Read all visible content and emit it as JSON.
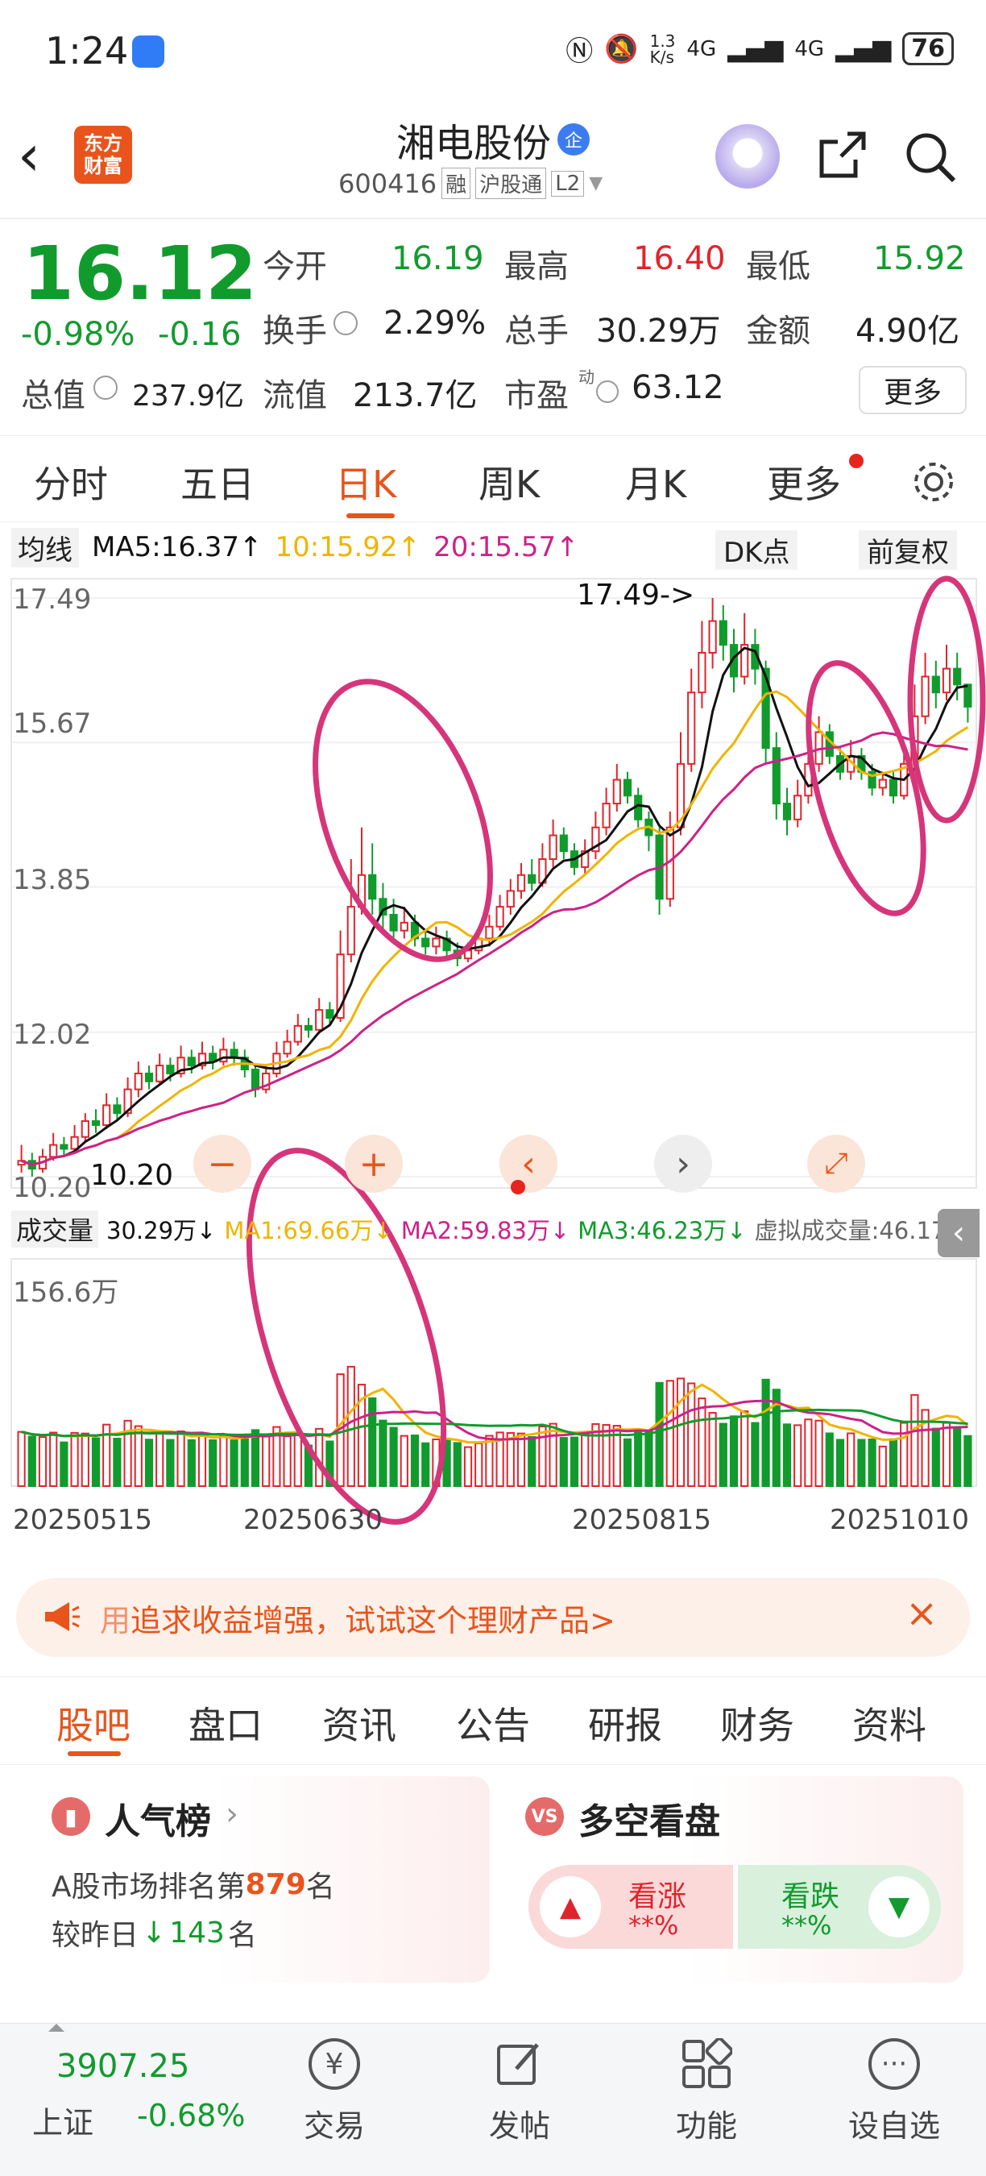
{
  "status_bar": {
    "time": "1:24",
    "net_speed_top": "1.3",
    "net_speed_unit": "K/s",
    "signal1": "4G",
    "signal2": "4G",
    "battery": "76"
  },
  "header": {
    "logo_line1": "东方",
    "logo_line2": "财富",
    "stock_name": "湘电股份",
    "badge": "企",
    "code": "600416",
    "tag1": "融",
    "tag2": "沪股通",
    "tag3": "L2"
  },
  "quote": {
    "price": "16.12",
    "change_pct": "-0.98%",
    "change": "-0.16",
    "open_label": "今开",
    "open": "16.19",
    "high_label": "最高",
    "high": "16.40",
    "low_label": "最低",
    "low": "15.92",
    "turnover_label": "换手",
    "turnover": "2.29%",
    "volume_label": "总手",
    "volume": "30.29万",
    "amount_label": "金额",
    "amount": "4.90亿",
    "mktcap_label": "总值",
    "mktcap": "237.9亿",
    "float_label": "流值",
    "float": "213.7亿",
    "pe_label": "市盈",
    "pe_sup": "动",
    "pe": "63.12",
    "more": "更多"
  },
  "tabs": [
    "分时",
    "五日",
    "日K",
    "周K",
    "月K",
    "更多"
  ],
  "active_tab": 2,
  "ma_bar": {
    "ma_type": "均线",
    "ma5": "MA5:16.37↑",
    "ma10": "10:15.92↑",
    "ma20": "20:15.57↑",
    "dk": "DK点",
    "adjust": "前复权"
  },
  "price_axis": [
    "17.49",
    "15.67",
    "13.85",
    "12.02",
    "10.20"
  ],
  "annotations": {
    "high_marker": "17.49->",
    "low_marker": "10.20"
  },
  "vol_bar": {
    "label": "成交量",
    "vol": "30.29万↓",
    "ma1": "MA1:69.66万↓",
    "ma2": "MA2:59.83万↓",
    "ma3": "MA3:46.23万↓",
    "virtual": "虚拟成交量:46.17万"
  },
  "vol_axis_top": "156.6万",
  "date_axis": [
    "20250515",
    "20250630",
    "20250815",
    "20251010"
  ],
  "colors": {
    "up": "#e0242c",
    "down": "#119b2d",
    "ma5": "#111111",
    "ma10": "#f0b400",
    "ma20": "#cc2288",
    "accent": "#e8541c"
  },
  "banner": {
    "text_prefix": "用",
    "text": "追求收益增强，试试这个理财产品>"
  },
  "subtabs": [
    "股吧",
    "盘口",
    "资讯",
    "公告",
    "研报",
    "财务",
    "资料"
  ],
  "active_subtab": 0,
  "popularity": {
    "title": "人气榜",
    "line1_prefix": "A股市场排名第",
    "rank": "879",
    "line1_suffix": "名",
    "line2_prefix": "较昨日",
    "delta": "143",
    "line2_suffix": "名"
  },
  "sentiment": {
    "title": "多空看盘",
    "bull": "看涨",
    "bull_val": "**%",
    "bear": "看跌",
    "bear_val": "**%"
  },
  "bottom_nav": {
    "index_value": "3907.25",
    "index_name": "上证",
    "index_change": "-0.68%",
    "items": [
      "交易",
      "发帖",
      "功能",
      "设自选"
    ]
  },
  "chart_data": {
    "type": "candlestick",
    "x_dates_shown": [
      "20250515",
      "20250630",
      "20250815",
      "20251010"
    ],
    "y_ticks": [
      17.49,
      15.67,
      13.85,
      12.02,
      10.2
    ],
    "ylim": [
      10.2,
      17.49
    ],
    "candles": [
      [
        10.35,
        10.4,
        10.25,
        10.6
      ],
      [
        10.4,
        10.3,
        10.2,
        10.5
      ],
      [
        10.3,
        10.45,
        10.25,
        10.55
      ],
      [
        10.45,
        10.6,
        10.4,
        10.75
      ],
      [
        10.6,
        10.55,
        10.45,
        10.7
      ],
      [
        10.55,
        10.7,
        10.5,
        10.85
      ],
      [
        10.7,
        10.9,
        10.65,
        11.0
      ],
      [
        10.9,
        10.85,
        10.75,
        11.05
      ],
      [
        10.85,
        11.1,
        10.8,
        11.25
      ],
      [
        11.1,
        11.0,
        10.9,
        11.2
      ],
      [
        11.0,
        11.3,
        10.95,
        11.45
      ],
      [
        11.3,
        11.5,
        11.2,
        11.65
      ],
      [
        11.5,
        11.4,
        11.3,
        11.6
      ],
      [
        11.4,
        11.6,
        11.35,
        11.75
      ],
      [
        11.6,
        11.5,
        11.4,
        11.7
      ],
      [
        11.5,
        11.7,
        11.45,
        11.85
      ],
      [
        11.7,
        11.6,
        11.5,
        11.8
      ],
      [
        11.6,
        11.75,
        11.55,
        11.9
      ],
      [
        11.75,
        11.65,
        11.55,
        11.85
      ],
      [
        11.65,
        11.8,
        11.6,
        11.95
      ],
      [
        11.8,
        11.7,
        11.6,
        11.9
      ],
      [
        11.7,
        11.55,
        11.45,
        11.8
      ],
      [
        11.55,
        11.3,
        11.2,
        11.6
      ],
      [
        11.3,
        11.5,
        11.25,
        11.6
      ],
      [
        11.5,
        11.75,
        11.45,
        11.9
      ],
      [
        11.75,
        11.9,
        11.7,
        12.05
      ],
      [
        11.9,
        12.1,
        11.85,
        12.25
      ],
      [
        12.1,
        12.05,
        11.95,
        12.2
      ],
      [
        12.05,
        12.3,
        12.0,
        12.45
      ],
      [
        12.3,
        12.2,
        12.1,
        12.4
      ],
      [
        12.2,
        13.0,
        12.15,
        13.3
      ],
      [
        13.0,
        13.6,
        12.9,
        14.2
      ],
      [
        13.6,
        14.0,
        13.5,
        14.6
      ],
      [
        14.0,
        13.7,
        13.5,
        14.4
      ],
      [
        13.7,
        13.5,
        13.3,
        13.9
      ],
      [
        13.5,
        13.3,
        13.2,
        13.7
      ],
      [
        13.3,
        13.4,
        13.2,
        13.6
      ],
      [
        13.4,
        13.2,
        13.1,
        13.5
      ],
      [
        13.2,
        13.1,
        13.0,
        13.3
      ],
      [
        13.1,
        13.2,
        13.0,
        13.35
      ],
      [
        13.2,
        13.05,
        12.95,
        13.3
      ],
      [
        13.05,
        12.95,
        12.85,
        13.15
      ],
      [
        12.95,
        13.05,
        12.9,
        13.15
      ],
      [
        13.05,
        13.2,
        13.0,
        13.3
      ],
      [
        13.2,
        13.35,
        13.1,
        13.5
      ],
      [
        13.35,
        13.6,
        13.3,
        13.75
      ],
      [
        13.6,
        13.8,
        13.5,
        13.95
      ],
      [
        13.8,
        14.0,
        13.7,
        14.15
      ],
      [
        14.0,
        13.9,
        13.8,
        14.2
      ],
      [
        13.9,
        14.2,
        13.85,
        14.4
      ],
      [
        14.2,
        14.5,
        14.1,
        14.7
      ],
      [
        14.5,
        14.3,
        14.2,
        14.6
      ],
      [
        14.3,
        14.1,
        14.0,
        14.4
      ],
      [
        14.1,
        14.3,
        14.0,
        14.45
      ],
      [
        14.3,
        14.6,
        14.2,
        14.8
      ],
      [
        14.6,
        14.9,
        14.5,
        15.1
      ],
      [
        14.9,
        15.2,
        14.8,
        15.4
      ],
      [
        15.2,
        15.0,
        14.9,
        15.3
      ],
      [
        15.0,
        14.7,
        14.6,
        15.1
      ],
      [
        14.7,
        14.5,
        14.3,
        14.8
      ],
      [
        14.5,
        13.7,
        13.5,
        14.6
      ],
      [
        13.7,
        14.6,
        13.6,
        14.8
      ],
      [
        14.6,
        15.4,
        14.5,
        15.8
      ],
      [
        15.4,
        16.3,
        15.3,
        16.6
      ],
      [
        16.3,
        16.8,
        16.1,
        17.2
      ],
      [
        16.8,
        17.2,
        16.6,
        17.49
      ],
      [
        17.2,
        16.9,
        16.7,
        17.4
      ],
      [
        16.9,
        16.5,
        16.3,
        17.1
      ],
      [
        16.5,
        16.9,
        16.4,
        17.3
      ],
      [
        16.9,
        16.6,
        16.4,
        17.1
      ],
      [
        16.6,
        15.6,
        15.4,
        16.7
      ],
      [
        15.6,
        14.9,
        14.7,
        15.8
      ],
      [
        14.9,
        14.7,
        14.5,
        15.1
      ],
      [
        14.7,
        15.0,
        14.6,
        15.2
      ],
      [
        15.0,
        15.4,
        14.9,
        15.6
      ],
      [
        15.4,
        15.8,
        15.3,
        16.0
      ],
      [
        15.8,
        15.5,
        15.4,
        15.9
      ],
      [
        15.5,
        15.3,
        15.2,
        15.6
      ],
      [
        15.3,
        15.5,
        15.2,
        15.7
      ],
      [
        15.5,
        15.3,
        15.2,
        15.6
      ],
      [
        15.3,
        15.1,
        15.0,
        15.4
      ],
      [
        15.1,
        15.2,
        15.0,
        15.3
      ],
      [
        15.2,
        15.0,
        14.9,
        15.3
      ],
      [
        15.0,
        15.4,
        14.95,
        15.6
      ],
      [
        15.4,
        16.0,
        15.3,
        16.4
      ],
      [
        16.0,
        16.5,
        15.9,
        16.8
      ],
      [
        16.5,
        16.3,
        16.1,
        16.7
      ],
      [
        16.3,
        16.6,
        16.2,
        16.9
      ],
      [
        16.6,
        16.4,
        16.2,
        16.8
      ],
      [
        16.4,
        16.12,
        15.92,
        16.4
      ]
    ],
    "ma5_last": 16.37,
    "ma10_last": 15.92,
    "ma20_last": 15.57,
    "volume_ylim": [
      0,
      156.6
    ],
    "volume_unit": "万"
  }
}
